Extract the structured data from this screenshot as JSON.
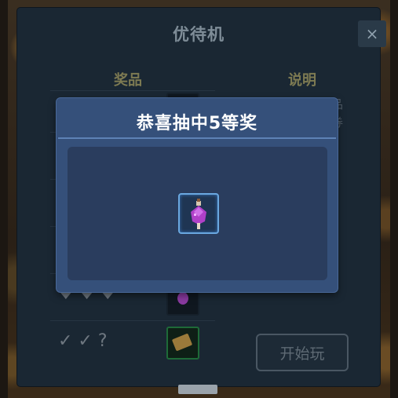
{
  "window": {
    "title": "优待机",
    "close_icon": "×"
  },
  "table": {
    "col_prize": "奖品",
    "col_desc": "说明",
    "rows": [
      {
        "symbols": "☀",
        "slot": "dark"
      },
      {
        "symbols": "☾",
        "slot": "dark"
      },
      {
        "symbols": "★",
        "slot": "dark"
      },
      {
        "symbols": "💧",
        "slot": "dark"
      },
      {
        "symbols": "♥ ♥ ♥",
        "slot": "potion"
      },
      {
        "symbols": "✓ ✓ ?",
        "slot": "ticket"
      }
    ],
    "desc_fragments": [
      "品",
      "券",
      "2"
    ]
  },
  "start_button": "开始玩",
  "popup": {
    "title": "恭喜抽中5等奖",
    "prize_icon": "potion-icon",
    "prize_color": "#b040c8"
  }
}
